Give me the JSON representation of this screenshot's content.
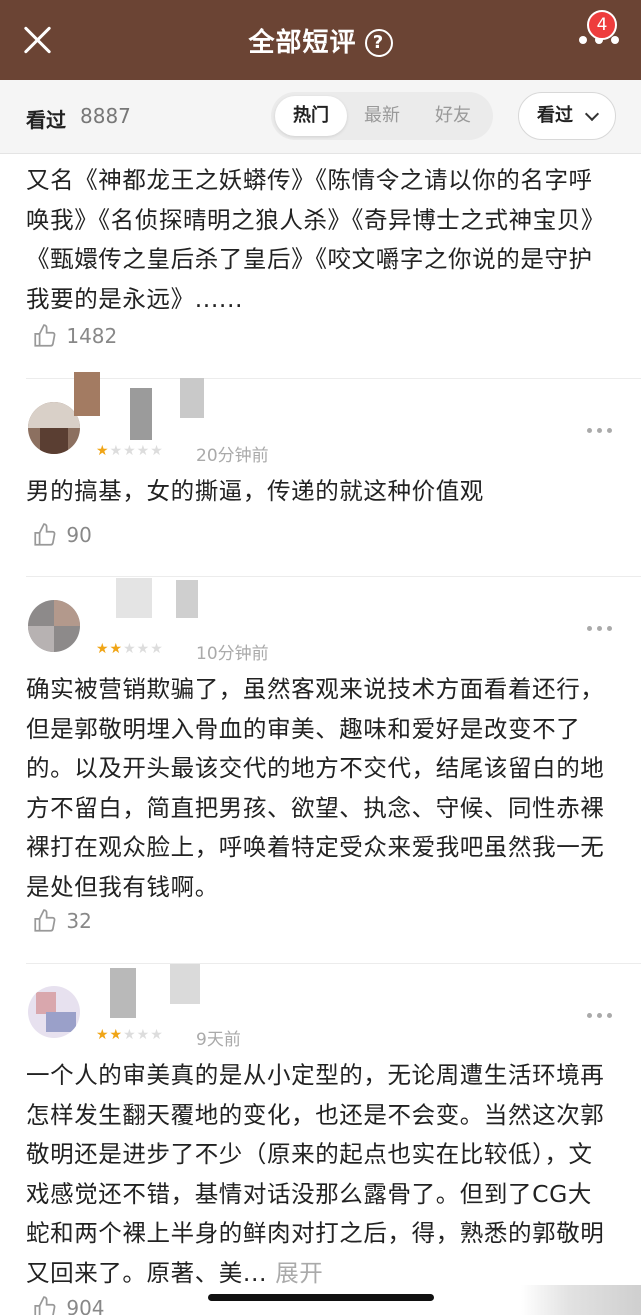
{
  "header": {
    "title": "全部短评",
    "badge_count": "4",
    "icons": {
      "close": "close-icon",
      "help": "help-circle-icon",
      "more": "more-horizontal-icon"
    }
  },
  "filter": {
    "seen_label": "看过",
    "seen_count": "8887",
    "tabs": [
      {
        "label": "热门",
        "active": true
      },
      {
        "label": "最新",
        "active": false
      },
      {
        "label": "好友",
        "active": false
      }
    ],
    "dropdown_label": "看过"
  },
  "reviews": [
    {
      "text": "又名《神都龙王之妖蟒传》《陈情令之请以你的名字呼唤我》《名侦探晴明之狼人杀》《奇异博士之式神宝贝》《甄嬛传之皇后杀了皇后》《咬文嚼字之你说的是守护我要的是永远》......",
      "likes": "1482"
    },
    {
      "stars": 1,
      "time": "20分钟前",
      "text": "男的搞基，女的撕逼，传递的就这种价值观",
      "likes": "90"
    },
    {
      "stars": 2,
      "time": "10分钟前",
      "text": "确实被营销欺骗了，虽然客观来说技术方面看着还行，但是郭敬明埋入骨血的审美、趣味和爱好是改变不了的。以及开头最该交代的地方不交代，结尾该留白的地方不留白，简直把男孩、欲望、执念、守候、同性赤裸裸打在观众脸上，呼唤着特定受众来爱我吧虽然我一无是处但我有钱啊。",
      "likes": "32"
    },
    {
      "stars": 2,
      "time": "9天前",
      "text": "一个人的审美真的是从小定型的，无论周遭生活环境再怎样发生翻天覆地的变化，也还是不会变。当然这次郭敬明还是进步了不少（原来的起点也实在比较低），文戏感觉还不错，基情对话没那么露骨了。但到了CG大蛇和两个裸上半身的鲜肉对打之后，得，熟悉的郭敬明又回来了。原著、美...",
      "expand_label": "展开",
      "likes": "904"
    }
  ],
  "colors": {
    "header_bg": "#6b4434",
    "star_on": "#f0a516",
    "star_off": "#dddddd",
    "badge": "#ee3d3d"
  }
}
